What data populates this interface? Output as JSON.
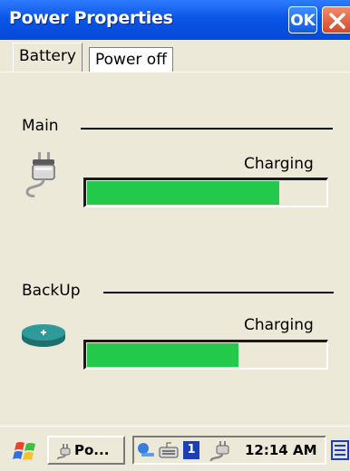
{
  "window": {
    "title": "Power Properties",
    "ok_label": "OK"
  },
  "tabs": [
    {
      "label": "Battery",
      "active": true
    },
    {
      "label": "Power off",
      "active": false
    }
  ],
  "main_battery": {
    "label": "Main",
    "status": "Charging",
    "level_percent": 80,
    "icon": "power-plug-icon"
  },
  "backup_battery": {
    "label": "BackUp",
    "status": "Charging",
    "level_percent": 63,
    "icon": "coin-cell-battery-icon"
  },
  "taskbar": {
    "task_label": "Po...",
    "clock": "12:14 AM",
    "tray_badge": "1"
  },
  "colors": {
    "titlebar": "#0a56e6",
    "progress_fill": "#22c94a",
    "background": "#ece9d8",
    "close_button": "#d6482a"
  }
}
